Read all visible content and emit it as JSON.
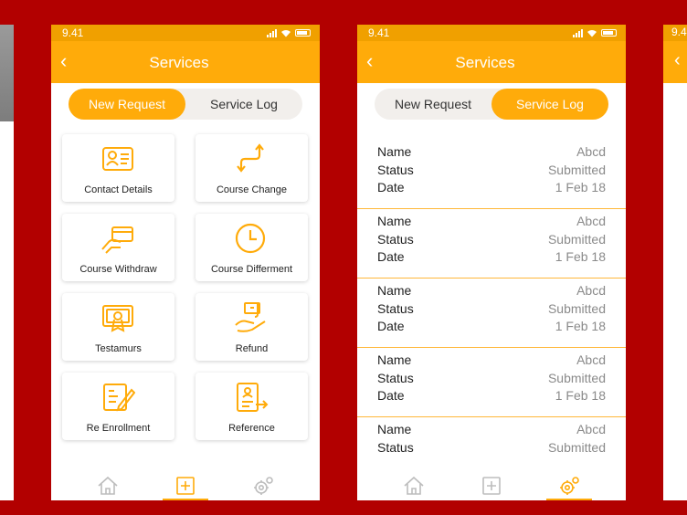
{
  "status_bar": {
    "time": "9.41"
  },
  "ghost_right": {
    "time": "9.4",
    "back": "‹"
  },
  "colors": {
    "accent": "#ffab0a",
    "status": "#f0a000",
    "background": "#b20000"
  },
  "screen_new_request": {
    "back_icon": "back-chevron-icon",
    "title": "Services",
    "tabs": [
      {
        "label": "New Request",
        "active": true
      },
      {
        "label": "Service Log",
        "active": false
      }
    ],
    "services": [
      {
        "label": "Contact Details",
        "icon": "contact-card-icon"
      },
      {
        "label": "Course Change",
        "icon": "course-change-icon"
      },
      {
        "label": "Course Withdraw",
        "icon": "card-in-hand-icon"
      },
      {
        "label": "Course Differment",
        "icon": "clock-icon"
      },
      {
        "label": "Testamurs",
        "icon": "certificate-icon"
      },
      {
        "label": "Refund",
        "icon": "refund-hand-icon"
      },
      {
        "label": "Re Enrollment",
        "icon": "form-edit-icon"
      },
      {
        "label": "Reference",
        "icon": "reference-document-icon"
      }
    ],
    "bottom_nav": [
      {
        "icon": "home-icon",
        "active": false
      },
      {
        "icon": "add-box-icon",
        "active": true
      },
      {
        "icon": "settings-gear-icon",
        "active": false
      }
    ]
  },
  "screen_service_log": {
    "back_icon": "back-chevron-icon",
    "title": "Services",
    "tabs": [
      {
        "label": "New Request",
        "active": false
      },
      {
        "label": "Service Log",
        "active": true
      }
    ],
    "labels": {
      "name": "Name",
      "status": "Status",
      "date": "Date"
    },
    "entries": [
      {
        "name": "Abcd",
        "status": "Submitted",
        "date": "1 Feb 18"
      },
      {
        "name": "Abcd",
        "status": "Submitted",
        "date": "1 Feb 18"
      },
      {
        "name": "Abcd",
        "status": "Submitted",
        "date": "1 Feb 18"
      },
      {
        "name": "Abcd",
        "status": "Submitted",
        "date": "1 Feb 18"
      },
      {
        "name": "Abcd",
        "status": "Submitted"
      }
    ],
    "bottom_nav": [
      {
        "icon": "home-icon",
        "active": false
      },
      {
        "icon": "add-box-icon",
        "active": false
      },
      {
        "icon": "settings-gear-icon",
        "active": true
      }
    ]
  }
}
